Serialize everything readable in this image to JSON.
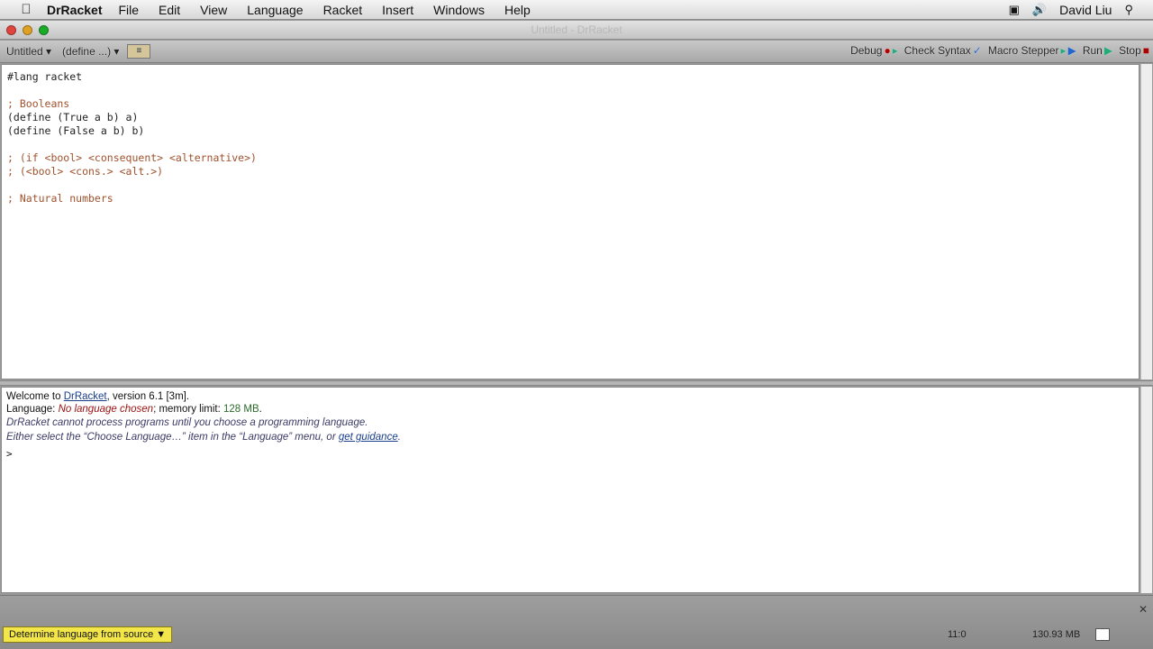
{
  "menubar": {
    "app_name": "DrRacket",
    "items": [
      "File",
      "Edit",
      "View",
      "Language",
      "Racket",
      "Insert",
      "Windows",
      "Help"
    ],
    "user": "David Liu"
  },
  "window": {
    "title": "Untitled - DrRacket"
  },
  "toolbar": {
    "file_popup": "Untitled",
    "define_popup": "(define ...)",
    "debug": "Debug",
    "check_syntax": "Check Syntax",
    "macro_stepper": "Macro Stepper",
    "run": "Run",
    "stop": "Stop"
  },
  "definitions": {
    "lines": [
      {
        "text": "#lang racket",
        "kind": "code"
      },
      {
        "text": "",
        "kind": "blank"
      },
      {
        "text": "; Booleans",
        "kind": "comment"
      },
      {
        "text": "(define (True a b) a)",
        "kind": "code"
      },
      {
        "text": "(define (False a b) b)",
        "kind": "code"
      },
      {
        "text": "",
        "kind": "blank"
      },
      {
        "text": "; (if <bool> <consequent> <alternative>)",
        "kind": "comment"
      },
      {
        "text": "; (<bool> <cons.> <alt.>)",
        "kind": "comment"
      },
      {
        "text": "",
        "kind": "blank"
      },
      {
        "text": "; Natural numbers",
        "kind": "comment"
      }
    ]
  },
  "interactions": {
    "welcome_prefix": "Welcome to ",
    "welcome_link": "DrRacket",
    "welcome_suffix": ", version 6.1 [3m].",
    "language_label": "Language: ",
    "language_value": "No language chosen",
    "memory_label": "; memory limit: ",
    "memory_value": "128 MB",
    "memory_suffix": ".",
    "cannot_process": "DrRacket cannot process programs until you choose a programming language.",
    "guidance_prefix": "Either select the “Choose Language…” item in the “Language” menu, or ",
    "guidance_link": "get guidance",
    "guidance_suffix": ".",
    "prompt": ">"
  },
  "statusbar": {
    "language_button": "Determine language from source",
    "position": "11:0",
    "memory": "130.93 MB"
  },
  "colors": {
    "comment": "#a0522d",
    "link": "#1a3e8c",
    "error": "#9b1010",
    "language_button": "#f2e64a"
  }
}
